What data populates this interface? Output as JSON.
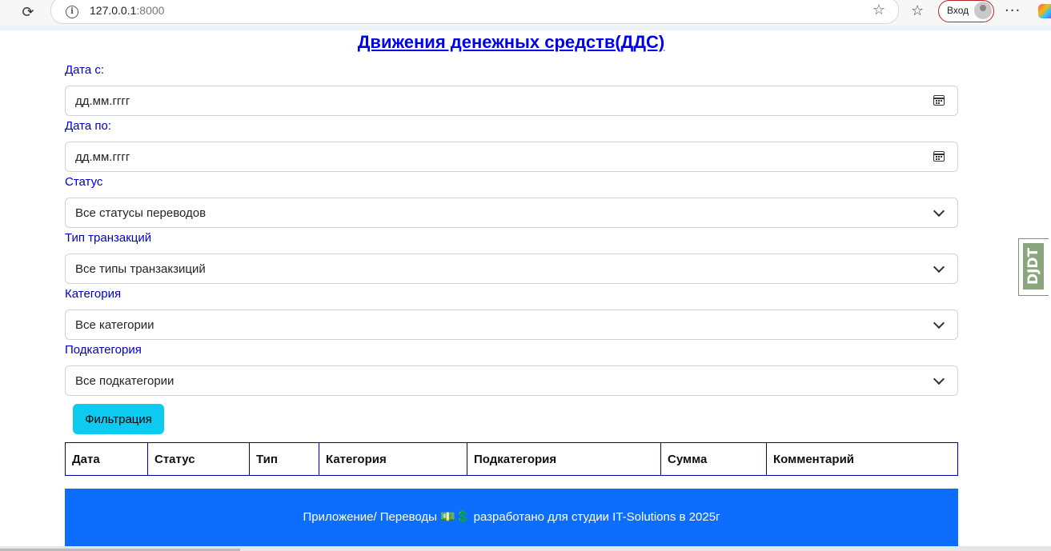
{
  "browser": {
    "url_host": "127.0.0.1",
    "url_port": ":8000",
    "login_label": "Вход"
  },
  "page": {
    "title": "Движения денежных средств(ДДС)"
  },
  "filters": {
    "date_from": {
      "label": "Дата с:",
      "placeholder": "дд.мм.гггг"
    },
    "date_to": {
      "label": "Дата по:",
      "placeholder": "дд.мм.гггг"
    },
    "status": {
      "label": "Статус",
      "value": "Все статусы переводов"
    },
    "type": {
      "label": "Тип транзакций",
      "value": "Все типы транзакзиций"
    },
    "category": {
      "label": "Категория",
      "value": "Все категории"
    },
    "subcategory": {
      "label": "Подкатегория",
      "value": "Все подкатегории"
    },
    "submit_label": "Фильтрация"
  },
  "table": {
    "headers": [
      "Дата",
      "Статус",
      "Тип",
      "Категория",
      "Подкатегория",
      "Сумма",
      "Комментарий"
    ]
  },
  "footer": {
    "text": "Приложение/ Переводы 💵💲 разработано для студии IT-Solutions в 2025г"
  },
  "debug_toolbar": {
    "label": "DJDT"
  },
  "colors": {
    "accent_button": "#0dcaf0",
    "footer_bg": "#0d6efd",
    "label_color": "#0000cc",
    "title_color": "#0000ee"
  }
}
